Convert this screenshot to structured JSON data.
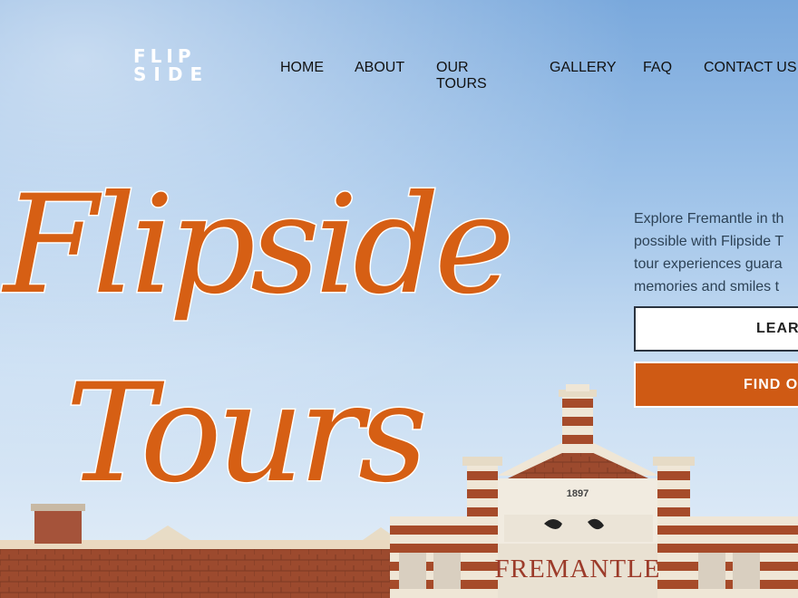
{
  "brand": {
    "logo_line1": "FLIP",
    "logo_line2": "SIDE",
    "accent_color": "#d65f14"
  },
  "nav": {
    "items": [
      "HOME",
      "ABOUT",
      "OUR TOURS",
      "GALLERY",
      "FAQ",
      "CONTACT US"
    ]
  },
  "hero": {
    "headline_line1": "Flipside",
    "headline_line2": "Tours",
    "intro_lines": [
      "Explore Fremantle in th",
      "possible with Flipside T",
      "tour experiences guara",
      "memories and smiles t"
    ],
    "learn_button": "LEARN",
    "find_button": "FIND O"
  },
  "building": {
    "year": "1897",
    "sign": "FREMANTLE"
  }
}
